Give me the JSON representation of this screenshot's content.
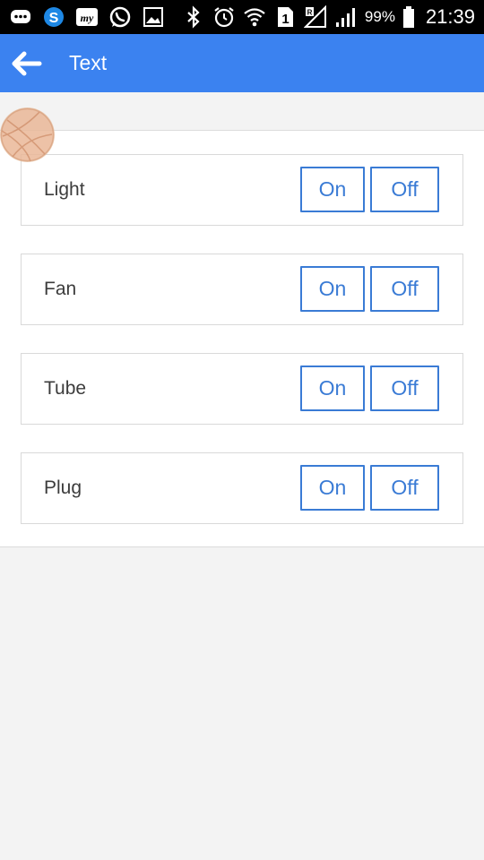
{
  "status_bar": {
    "battery_percent": "99%",
    "time": "21:39",
    "icons_left": [
      "message-icon",
      "skype-icon",
      "my-app-icon",
      "whatsapp-icon",
      "gallery-icon"
    ],
    "icons_right": [
      "bluetooth-icon",
      "alarm-icon",
      "wifi-icon",
      "sim-icon",
      "roaming-signal-icon",
      "signal-icon",
      "battery-icon"
    ]
  },
  "app_bar": {
    "title": "Text",
    "back_icon": "arrow-left-icon",
    "color": "#3b82f0"
  },
  "devices": [
    {
      "label": "Light",
      "on_label": "On",
      "off_label": "Off"
    },
    {
      "label": "Fan",
      "on_label": "On",
      "off_label": "Off"
    },
    {
      "label": "Tube",
      "on_label": "On",
      "off_label": "Off"
    },
    {
      "label": "Plug",
      "on_label": "On",
      "off_label": "Off"
    }
  ],
  "accent_color": "#3a7bd5"
}
